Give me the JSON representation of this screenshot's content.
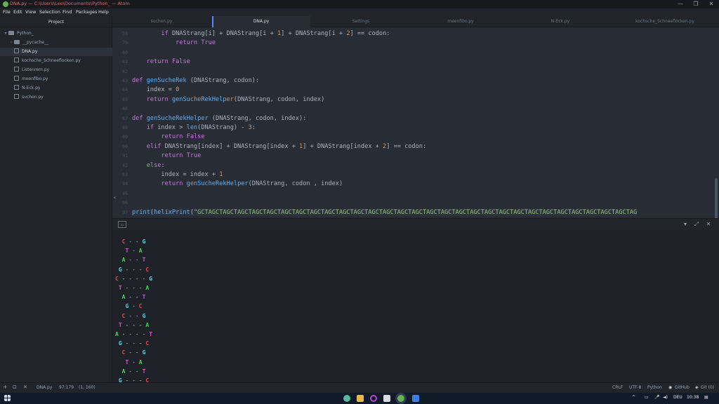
{
  "window": {
    "title": "DNA.py — C:\\Users\\Leo\\Documents\\Python_ — Atom",
    "controls": {
      "minimize": "—",
      "maximize": "❐",
      "close": "✕"
    }
  },
  "menu": [
    "File",
    "Edit",
    "View",
    "Selection",
    "Find",
    "Packages",
    "Help"
  ],
  "tree": {
    "header": "Project",
    "root": "Python_",
    "items": [
      {
        "label": "__pycache__",
        "type": "folder"
      },
      {
        "label": "DNA.py",
        "type": "file",
        "selected": true
      },
      {
        "label": "kochsche_Schneeflocken.py",
        "type": "file"
      },
      {
        "label": "Listenrem.py",
        "type": "file"
      },
      {
        "label": "meenfibo.py",
        "type": "file"
      },
      {
        "label": "N-Eck.py",
        "type": "file"
      },
      {
        "label": "suchen.py",
        "type": "file"
      }
    ]
  },
  "tabs": [
    {
      "label": "suchen.py",
      "active": false
    },
    {
      "label": "DNA.py",
      "active": true
    },
    {
      "label": "Settings",
      "active": false
    },
    {
      "label": "meenfibo.py",
      "active": false
    },
    {
      "label": "N-Eck.py",
      "active": false
    },
    {
      "label": "kochsche_Schneeflocken.py",
      "active": false
    }
  ],
  "editor": {
    "gutter": [
      "78",
      "79",
      "80",
      "81",
      "82",
      "83",
      "84",
      "85",
      "86",
      "87",
      "88",
      "89",
      "90",
      "91",
      "92",
      "93",
      "94",
      "95",
      "96",
      "97"
    ],
    "lines": [
      {
        "indent": "        ",
        "text": "if DNAStrang[i] + DNAStrang[i + 1] + DNAStrang[i + 2] == codon:"
      },
      {
        "indent": "            ",
        "text": "return True"
      },
      {
        "indent": "",
        "text": ""
      },
      {
        "indent": "    ",
        "text": "return False"
      },
      {
        "indent": "",
        "text": ""
      },
      {
        "indent": "",
        "text": "def genSucheRek (DNAStrang, codon):"
      },
      {
        "indent": "    ",
        "text": "index = 0"
      },
      {
        "indent": "    ",
        "text": "return genSucheRekHelper(DNAStrang, codon, index)"
      },
      {
        "indent": "",
        "text": ""
      },
      {
        "indent": "",
        "text": "def genSucheRekHelper (DNAStrang, codon, index):"
      },
      {
        "indent": "    ",
        "text": "if index > len(DNAStrang) - 3:"
      },
      {
        "indent": "        ",
        "text": "return False"
      },
      {
        "indent": "    ",
        "text": "elif DNAStrang[index] + DNAStrang[index + 1] + DNAStrang[index + 2] == codon:"
      },
      {
        "indent": "        ",
        "text": "return True"
      },
      {
        "indent": "    ",
        "text": "else:"
      },
      {
        "indent": "        ",
        "text": "index = index + 1"
      },
      {
        "indent": "        ",
        "text": "return genSucheRekHelper(DNAStrang, codon , index)"
      },
      {
        "indent": "",
        "text": ""
      },
      {
        "indent": "",
        "text": ""
      },
      {
        "indent": "",
        "text": "print(helixPrint(\"GCTAGCTAGCTAGCTAGCTAGCTAGCTAGCTAGCTAGCTAGCTAGCTAGCTAGCTAGCTAGCTAGCTAGCTAGCTAGCTAGCTAGCTAGCTAGCTAGCTAGCTAGCTAGCTAGCTAGCTAG"
      }
    ]
  },
  "terminal": {
    "helix": [
      [
        "C",
        "G",
        2
      ],
      [
        "T",
        "A",
        1
      ],
      [
        "A",
        "T",
        2
      ],
      [
        "G",
        "C",
        3
      ],
      [
        "C",
        "G",
        4
      ],
      [
        "T",
        "A",
        3
      ],
      [
        "A",
        "T",
        2
      ],
      [
        "G",
        "C",
        1
      ],
      [
        "C",
        "G",
        2
      ],
      [
        "T",
        "A",
        3
      ],
      [
        "A",
        "T",
        4
      ],
      [
        "G",
        "C",
        3
      ],
      [
        "C",
        "G",
        2
      ],
      [
        "T",
        "A",
        1
      ],
      [
        "A",
        "T",
        2
      ],
      [
        "G",
        "C",
        3
      ]
    ]
  },
  "statusbar": {
    "file": "DNA.py",
    "position": "97:179",
    "selection": "(1, 160)",
    "line_ending": "CRLF",
    "encoding": "UTF-8",
    "grammar": "Python",
    "github": "GitHub",
    "git": "Git (0)"
  },
  "taskbar": {
    "language": "DEU",
    "time": "10:38"
  }
}
